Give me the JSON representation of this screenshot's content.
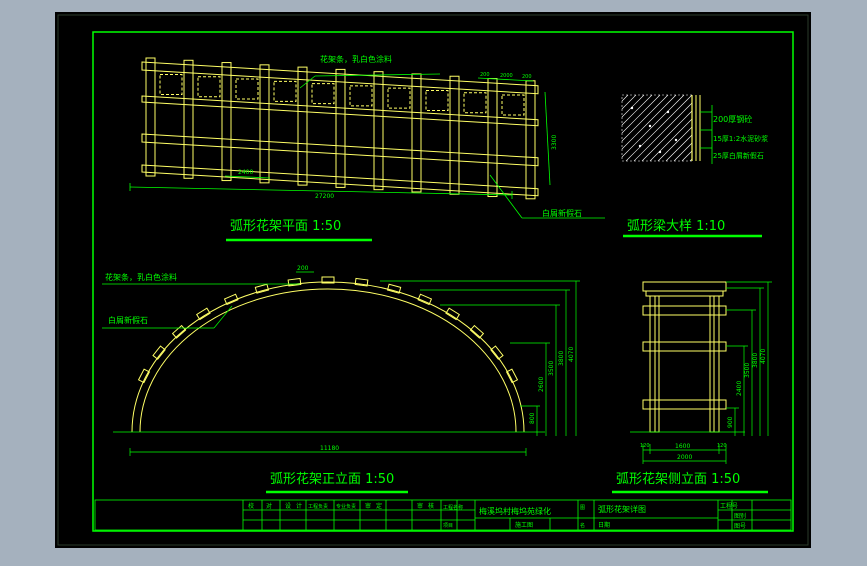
{
  "colors": {
    "background": "#a5b1be",
    "canvas": "#000000",
    "frame": "#00ff00",
    "drawing": "#ffff66",
    "dimension": "#00ff00",
    "text": "#00ff00",
    "hatch": "#ffffff"
  },
  "plan": {
    "title": "弧形花架平面 1:50",
    "label_top": "花架条，乳白色涂料",
    "label_stone": "白屑新假石",
    "dim_spacing": "2400",
    "dim_total": "27200",
    "dim_width": "3300",
    "dim_top": [
      "200",
      "2000",
      "200"
    ]
  },
  "detail": {
    "title": "弧形梁大样 1:10",
    "layers": [
      "200厚钢砼",
      "15厚1:2水泥砂浆",
      "25厚白屑新假石"
    ]
  },
  "front": {
    "title": "弧形花架正立面 1:50",
    "label_top": "花架条，乳白色涂料",
    "label_stone": "白屑新假石",
    "dim_top": "200",
    "dim_span": "11180",
    "dim_heights": [
      "800",
      "2600",
      "3500",
      "3800",
      "4070"
    ]
  },
  "side": {
    "title": "弧形花架侧立面 1:50",
    "dim_bottom_parts": [
      "120",
      "1600",
      "120"
    ],
    "dim_bottom_total": "2000",
    "dim_heights": [
      "900",
      "2400",
      "3500",
      "3800",
      "4070"
    ]
  },
  "titleblock": {
    "cells_left": [
      "校",
      "对",
      "设",
      "计",
      "工程负责",
      "专业负责",
      "审",
      "定",
      "审",
      "核"
    ],
    "project": "梅溪坞村梅坞苑绿化",
    "drawing_name": "弧形花架详图",
    "sub_project": "工程名称",
    "item_label": "项目",
    "phase": "施工图",
    "date_label": "日期",
    "sheet_labels": [
      "工程号",
      "图别",
      "图号"
    ]
  }
}
